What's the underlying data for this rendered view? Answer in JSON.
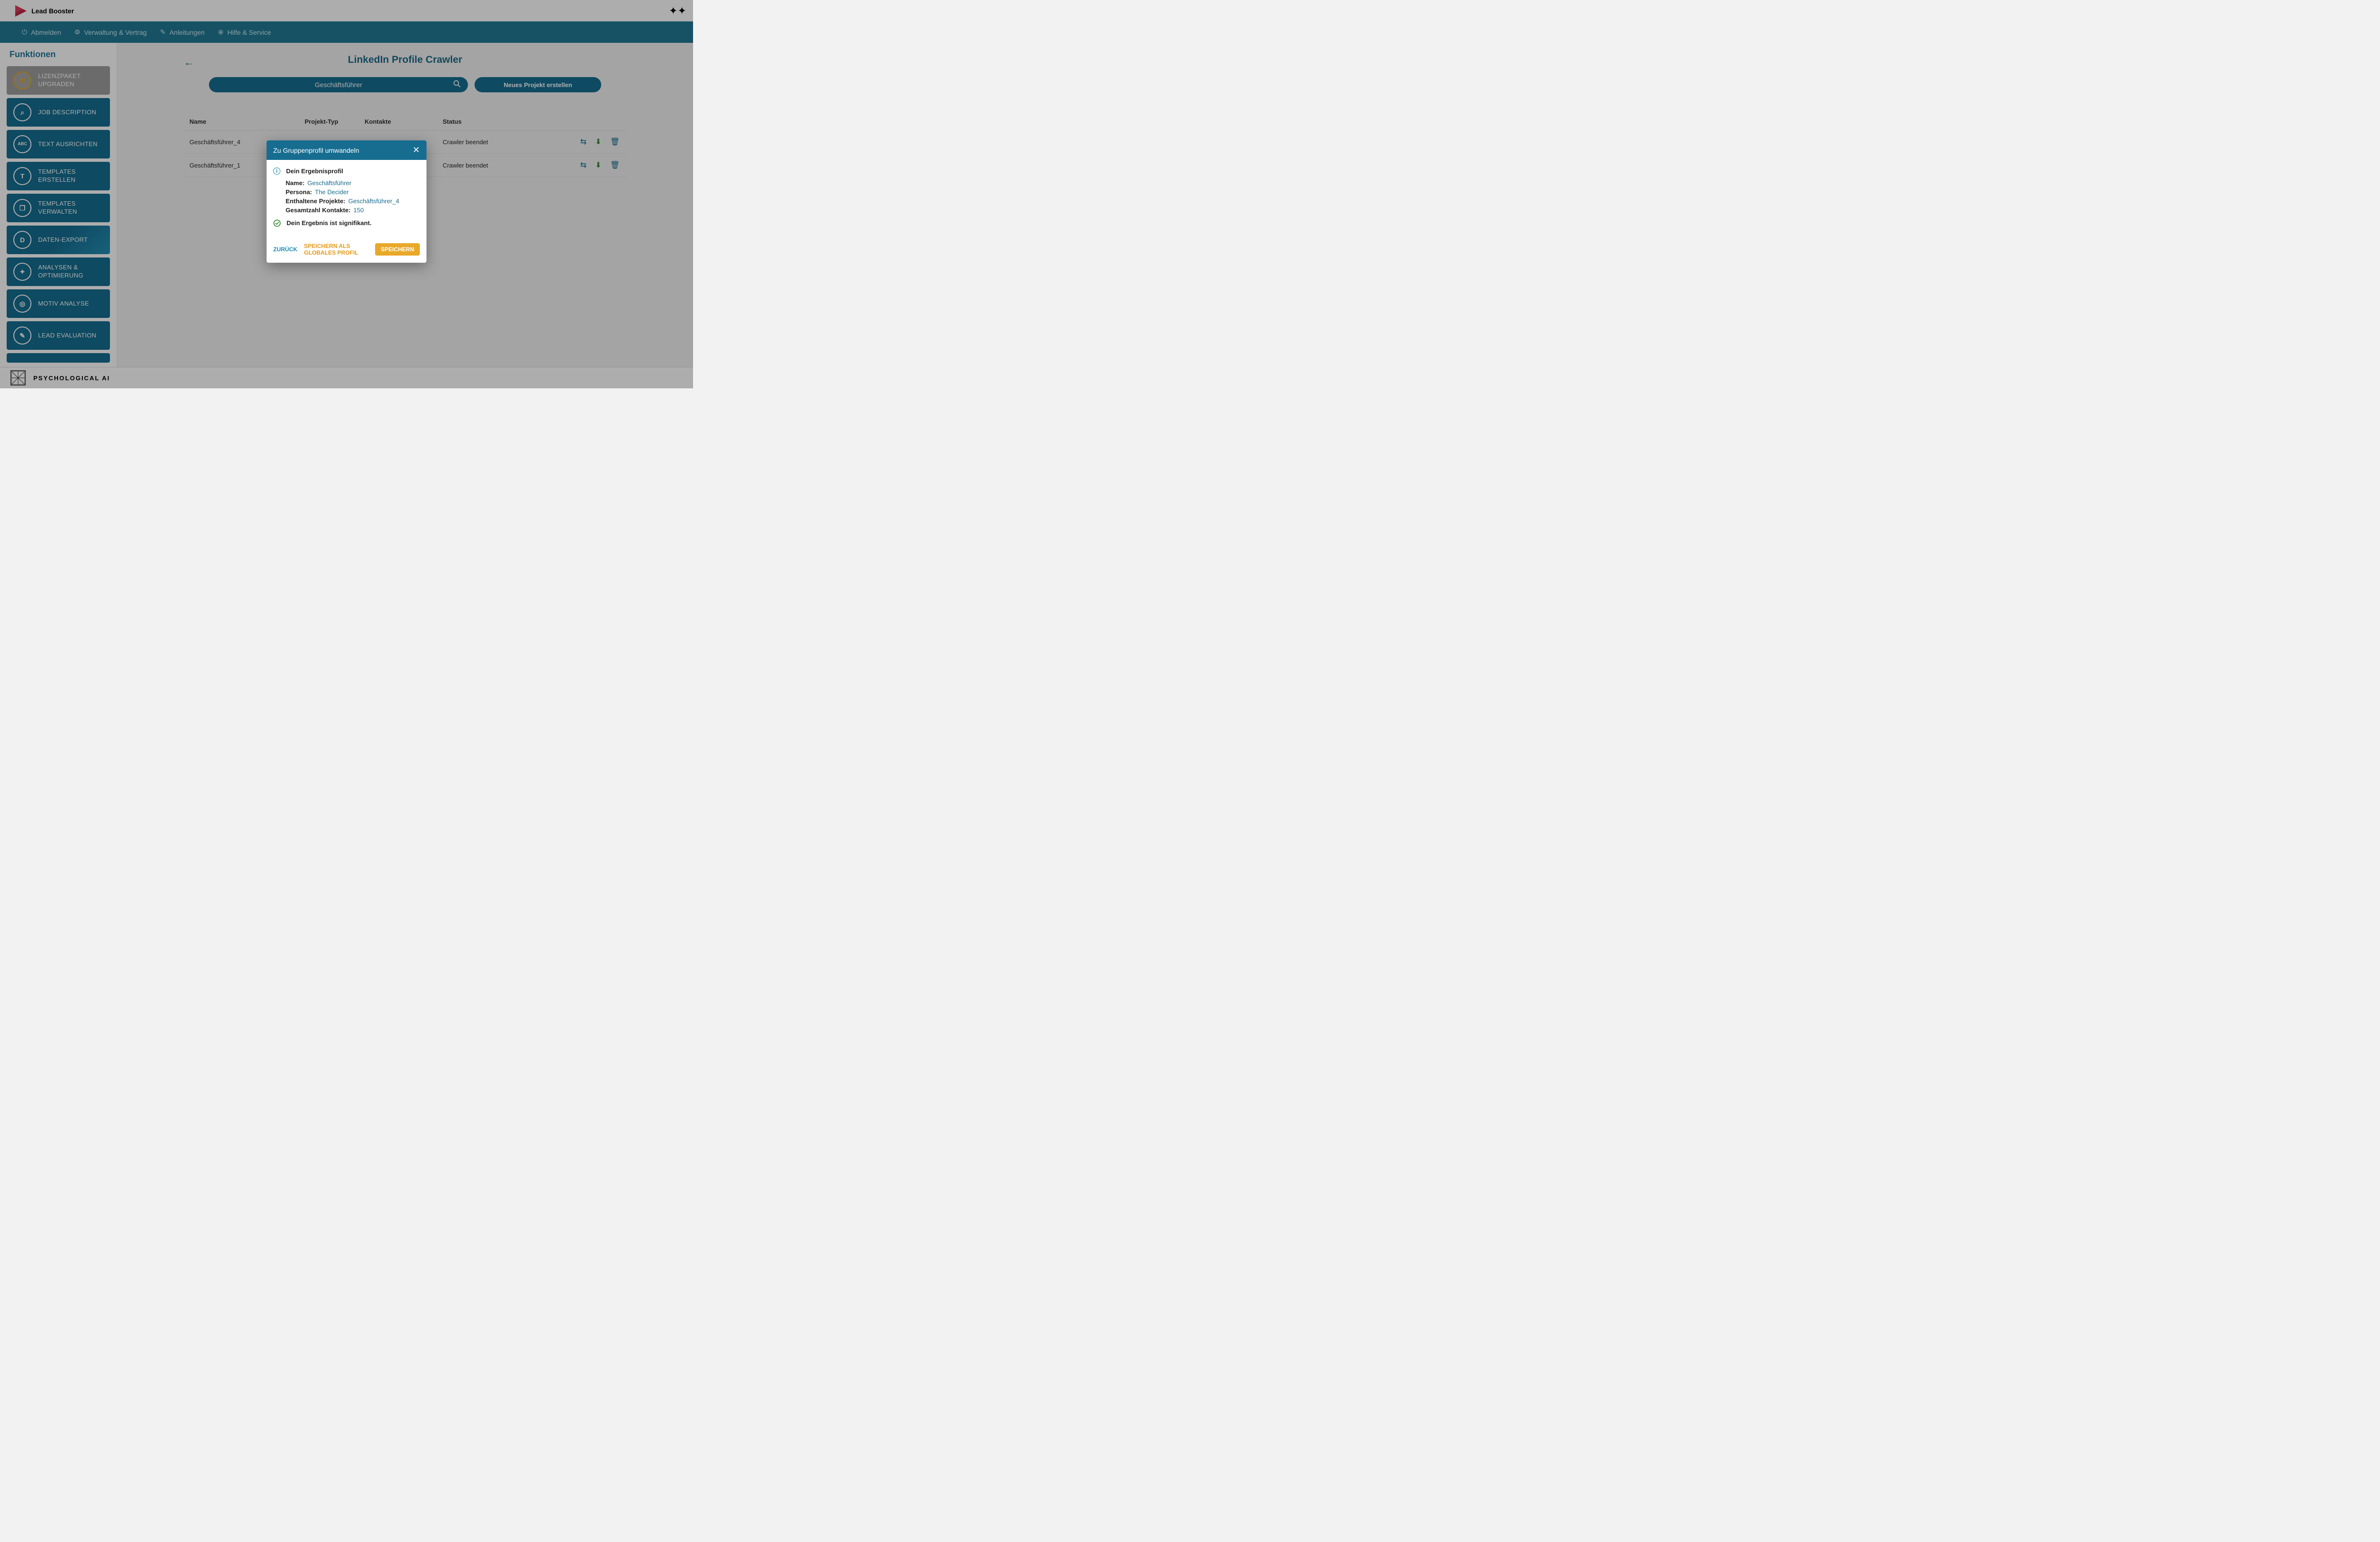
{
  "header": {
    "app_name": "Lead Booster"
  },
  "nav": {
    "logout": "Abmelden",
    "admin": "Verwaltung & Vertrag",
    "guides": "Anleitungen",
    "help": "Hilfe & Service"
  },
  "sidebar": {
    "title": "Funktionen",
    "items": [
      {
        "label": "LIZENZPAKET UPGRADEN",
        "icon": "⎚"
      },
      {
        "label": "JOB DESCRIPTION",
        "icon": "⌕"
      },
      {
        "label": "TEXT AUSRICHTEN",
        "icon": "ABC"
      },
      {
        "label": "TEMPLATES ERSTELLEN",
        "icon": "T"
      },
      {
        "label": "TEMPLATES VERWALTEN",
        "icon": "❐"
      },
      {
        "label": "DATEN-EXPORT",
        "icon": "D"
      },
      {
        "label": "ANALYSEN & OPTIMIERUNG",
        "icon": "✦"
      },
      {
        "label": "MOTIV ANALYSE",
        "icon": "◎"
      },
      {
        "label": "LEAD EVALUATION",
        "icon": "✎"
      }
    ]
  },
  "main": {
    "title": "LinkedIn Profile Crawler",
    "search_value": "Geschäftsführer",
    "new_project": "Neues Projekt erstellen",
    "columns": {
      "name": "Name",
      "type": "Projekt-Typ",
      "contacts": "Kontakte",
      "status": "Status"
    },
    "rows": [
      {
        "name": "Geschäftsführer_4",
        "status": "Crawler beendet"
      },
      {
        "name": "Geschäftsführer_1",
        "status": "Crawler beendet"
      }
    ]
  },
  "modal": {
    "title": "Zu Gruppenprofil umwandeln",
    "result_heading": "Dein Ergebnisprofil",
    "fields": {
      "name_label": "Name:",
      "name_value": "Geschäftsführer",
      "persona_label": "Persona:",
      "persona_value": "The Decider",
      "projects_label": "Enthaltene Projekte:",
      "projects_value": "Geschäftsführer_4",
      "contacts_label": "Gesamtzahl Kontakte:",
      "contacts_value": "150"
    },
    "significance": "Dein Ergebnis ist signifikant.",
    "actions": {
      "back": "ZURÜCK",
      "save_global": "SPEICHERN ALS GLOBALES PROFIL",
      "save": "SPEICHERN"
    }
  },
  "footer": {
    "brand": "PSYCHOLOGICAL AI"
  }
}
